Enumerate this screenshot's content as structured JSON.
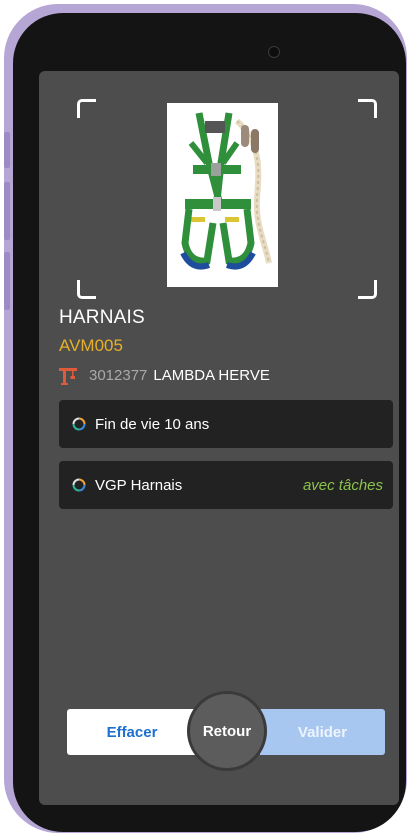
{
  "item": {
    "category": "HARNAIS",
    "code": "AVM005",
    "owner_id": "3012377",
    "owner_name": "LAMBDA HERVE"
  },
  "tasks": [
    {
      "label": "Fin de vie 10 ans",
      "extra": ""
    },
    {
      "label": "VGP Harnais",
      "extra": "avec tâches"
    }
  ],
  "buttons": {
    "clear": "Effacer",
    "back": "Retour",
    "validate": "Valider"
  },
  "icons": {
    "owner": "crane-icon",
    "task_status": "circular-progress-icon",
    "camera": "front-camera"
  },
  "colors": {
    "code": "#e7b02a",
    "task_extra": "#8bc34a",
    "primary": "#1e6fd0",
    "validate_disabled": "#a7c7f0"
  }
}
